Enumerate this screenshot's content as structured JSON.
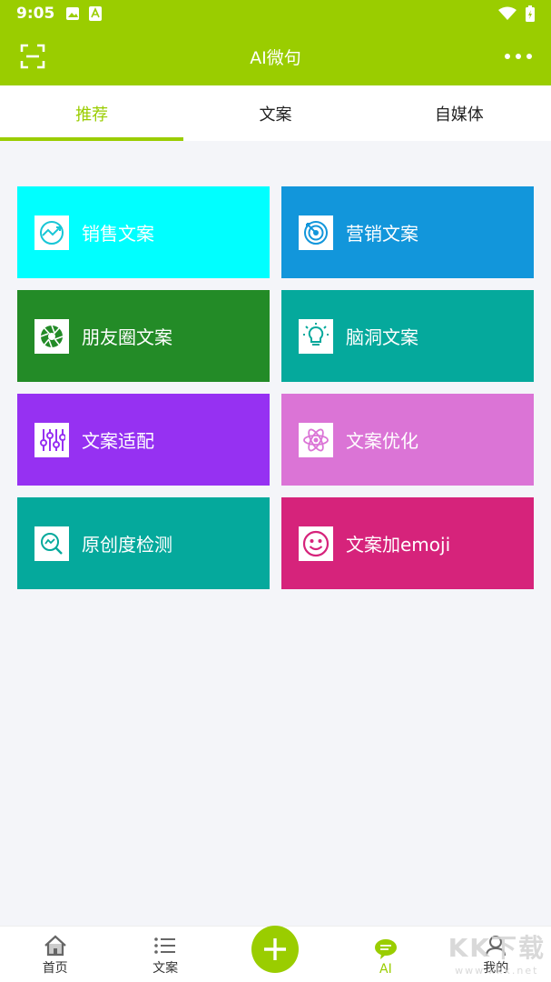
{
  "status_bar": {
    "time": "9:05"
  },
  "app_bar": {
    "title": "AI微句"
  },
  "tabs": [
    {
      "label": "推荐",
      "active": true
    },
    {
      "label": "文案",
      "active": false
    },
    {
      "label": "自媒体",
      "active": false
    }
  ],
  "cards": [
    {
      "label": "销售文案",
      "icon": "trend-chart-icon",
      "color": "#00ffff"
    },
    {
      "label": "营销文案",
      "icon": "target-icon",
      "color": "#1296db"
    },
    {
      "label": "朋友圈文案",
      "icon": "aperture-icon",
      "color": "#238b27"
    },
    {
      "label": "脑洞文案",
      "icon": "lightbulb-icon",
      "color": "#05a99c"
    },
    {
      "label": "文案适配",
      "icon": "sliders-icon",
      "color": "#9631f2"
    },
    {
      "label": "文案优化",
      "icon": "atom-icon",
      "color": "#db74d6"
    },
    {
      "label": "原创度检测",
      "icon": "magnifier-chart-icon",
      "color": "#05a99c"
    },
    {
      "label": "文案加emoji",
      "icon": "smiley-icon",
      "color": "#d6237b"
    }
  ],
  "bottom_nav": {
    "home": "首页",
    "copy": "文案",
    "ai": "AI",
    "me": "我的"
  },
  "watermark": {
    "main": "KK下载",
    "sub": "www.kkx.net"
  },
  "colors": {
    "brand": "#9acd00"
  }
}
